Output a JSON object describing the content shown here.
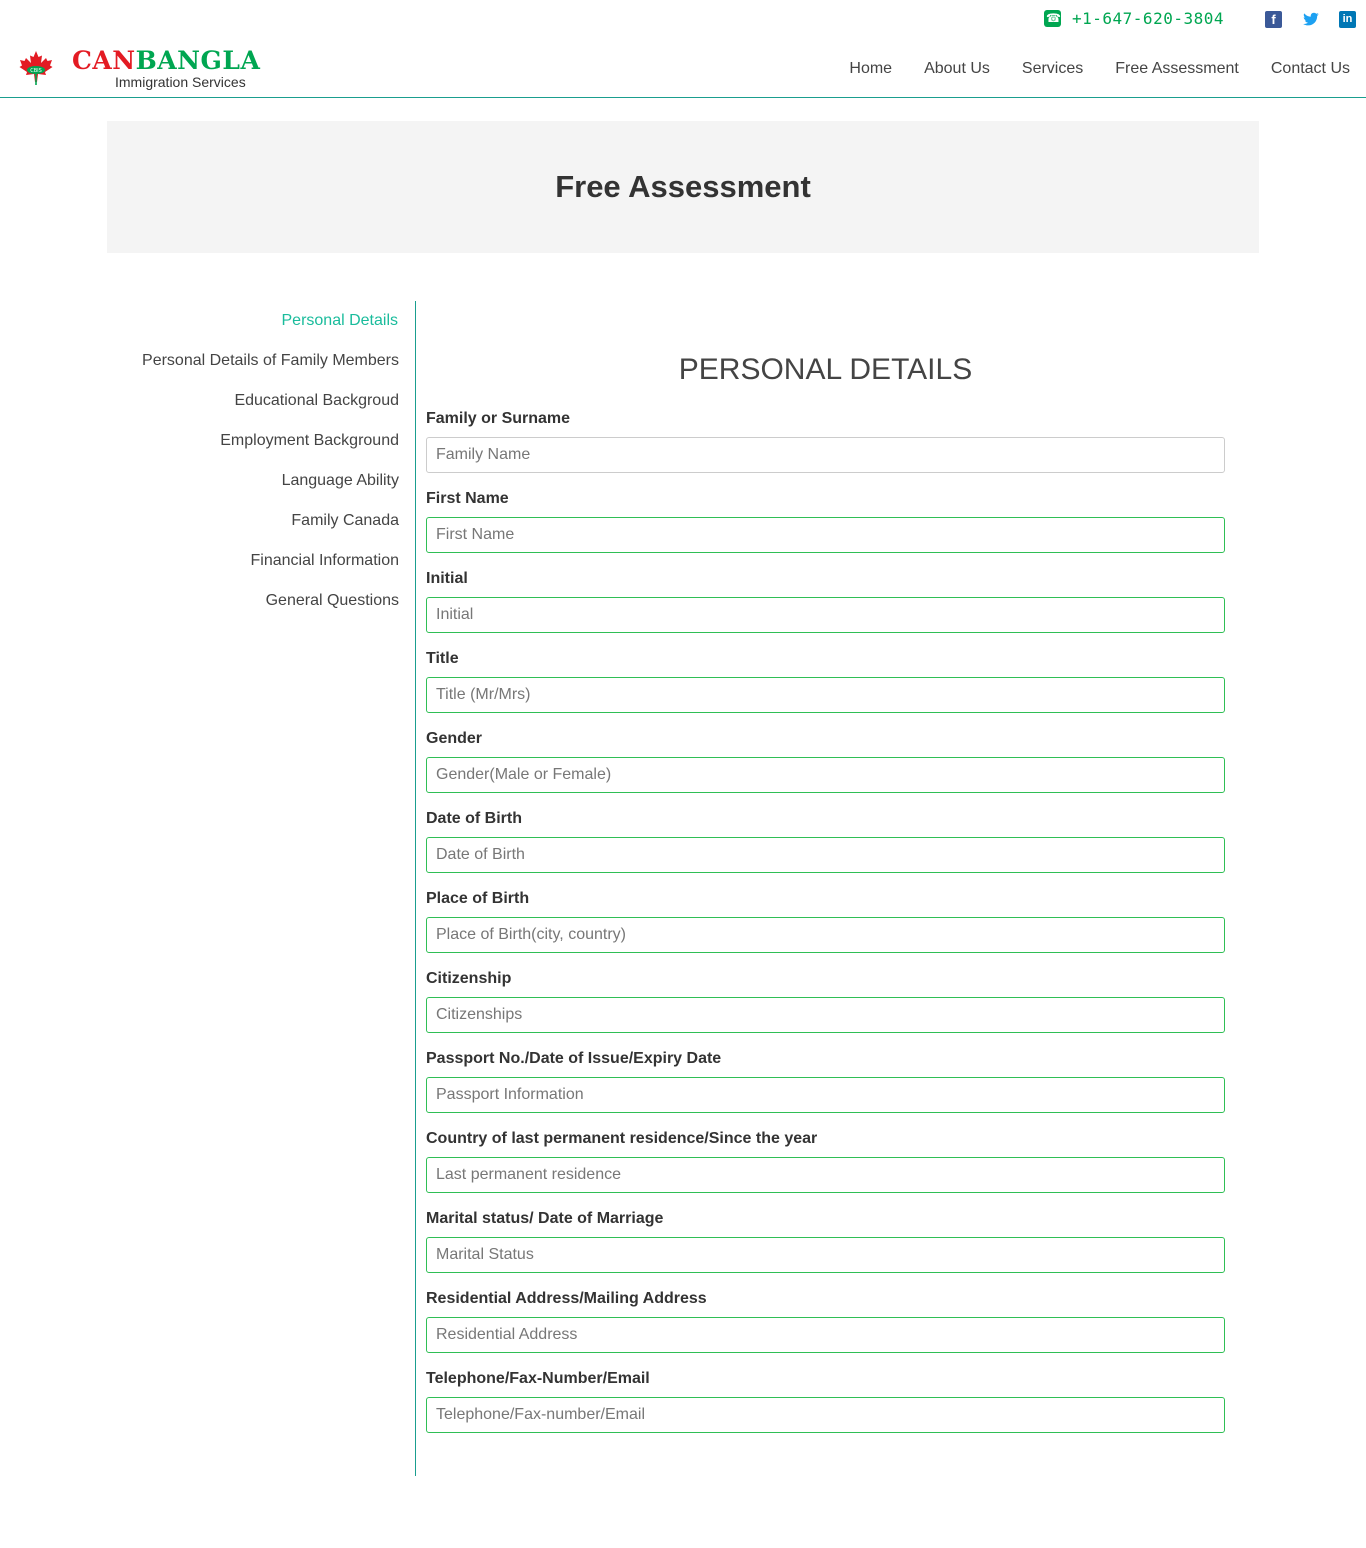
{
  "topbar": {
    "phone": "+1-647-620-3804",
    "social": [
      "facebook-icon",
      "twitter-icon",
      "linkedin-icon"
    ]
  },
  "brand": {
    "name_part1": "CAN",
    "name_part2": "BANGLA",
    "subtitle": "Immigration Services",
    "colors": {
      "red": "#e31b23",
      "green": "#00a651"
    }
  },
  "nav": {
    "items": [
      "Home",
      "About Us",
      "Services",
      "Free Assessment",
      "Contact Us"
    ]
  },
  "banner": {
    "title": "Free Assessment"
  },
  "sidebar": {
    "items": [
      "Personal Details",
      "Personal Details of Family Members",
      "Educational Backgroud",
      "Employment Background",
      "Language Ability",
      "Family Canada",
      "Financial Information",
      "General Questions"
    ],
    "active_color": "#1abc9c"
  },
  "form": {
    "title": "PERSONAL DETAILS",
    "fields": [
      {
        "label": "Family or Surname",
        "placeholder": "Family Name"
      },
      {
        "label": "First Name",
        "placeholder": "First Name"
      },
      {
        "label": "Initial",
        "placeholder": "Initial"
      },
      {
        "label": "Title",
        "placeholder": "Title (Mr/Mrs)"
      },
      {
        "label": "Gender",
        "placeholder": "Gender(Male or Female)"
      },
      {
        "label": "Date of Birth",
        "placeholder": "Date of Birth"
      },
      {
        "label": "Place of Birth",
        "placeholder": "Place of Birth(city, country)"
      },
      {
        "label": "Citizenship",
        "placeholder": "Citizenships"
      },
      {
        "label": "Passport No./Date of Issue/Expiry Date",
        "placeholder": "Passport Information"
      },
      {
        "label": "Country of last permanent residence/Since the year",
        "placeholder": "Last permanent residence"
      },
      {
        "label": "Marital status/ Date of Marriage",
        "placeholder": "Marital Status"
      },
      {
        "label": "Residential Address/Mailing Address",
        "placeholder": "Residential Address"
      },
      {
        "label": "Telephone/Fax-Number/Email",
        "placeholder": "Telephone/Fax-number/Email"
      }
    ],
    "accent_border": "#2fbf55"
  }
}
